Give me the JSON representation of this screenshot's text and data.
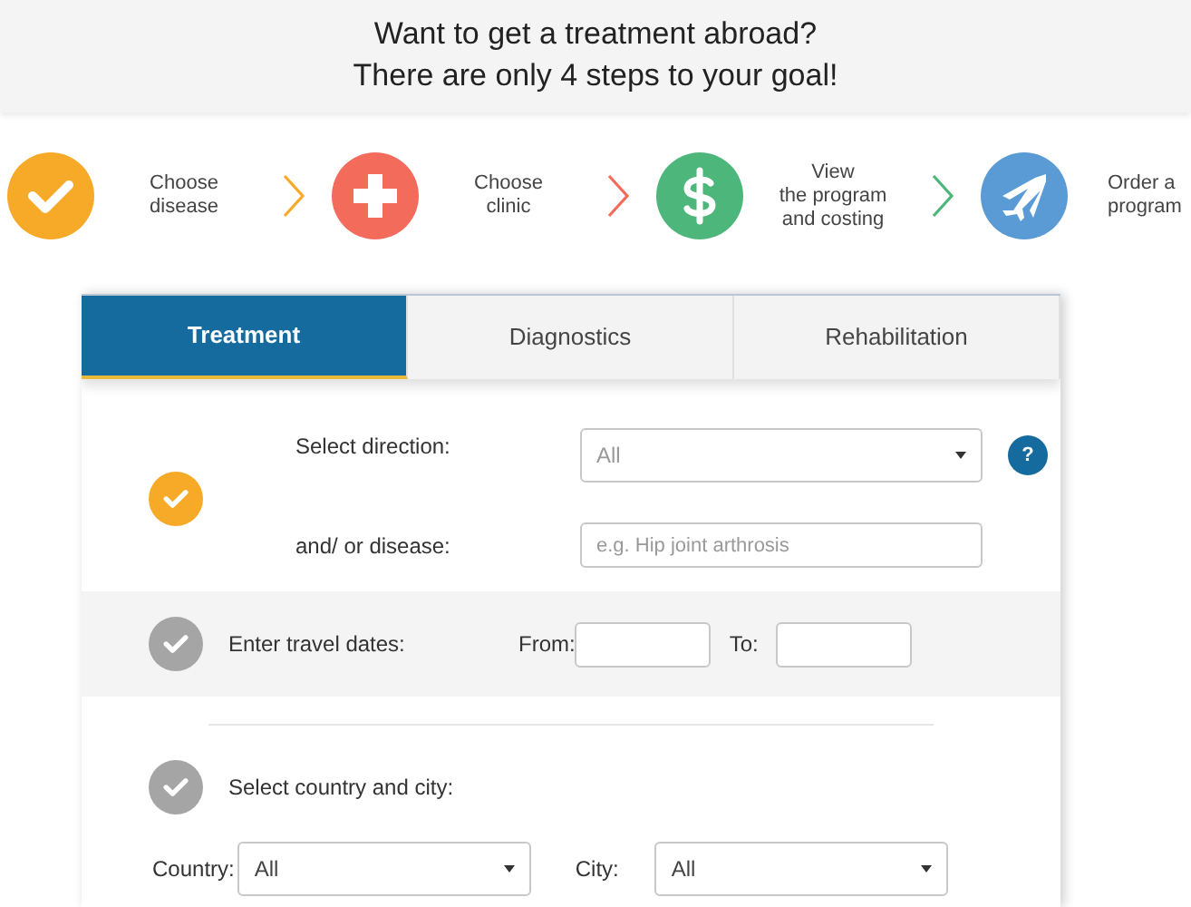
{
  "header": {
    "lines": [
      "Want to get a treatment abroad?",
      "There are only 4 steps to your goal!"
    ]
  },
  "steps": [
    {
      "kind": "check",
      "color": "#f7a928",
      "lines": [
        "Choose",
        "disease"
      ]
    },
    {
      "kind": "cross",
      "color": "#f26b5b",
      "lines": [
        "Choose",
        "clinic"
      ]
    },
    {
      "kind": "dollar",
      "color": "#4db67a",
      "lines": [
        "View",
        "the program",
        "and costing"
      ]
    },
    {
      "kind": "plane",
      "color": "#5b9bd5",
      "lines": [
        "Order a",
        "program"
      ]
    }
  ],
  "tabs": [
    {
      "label": "Treatment",
      "selected": true
    },
    {
      "label": "Diagnostics",
      "selected": false
    },
    {
      "label": "Rehabilitation",
      "selected": false
    }
  ],
  "direction": {
    "color": "#f7a928",
    "label": "Select direction:",
    "select_value": "All",
    "help": "?",
    "disease_label": "and/ or disease:",
    "disease_placeholder": "e.g. Hip joint arthrosis"
  },
  "dates": {
    "color": "#a5a5a5",
    "label": "Enter travel dates:",
    "from_label": "From:",
    "to_label": "To:"
  },
  "location": {
    "color": "#a5a5a5",
    "label": "Select country and city:",
    "country_label": "Country:",
    "country_value": "All",
    "city_label": "City:",
    "city_value": "All"
  }
}
